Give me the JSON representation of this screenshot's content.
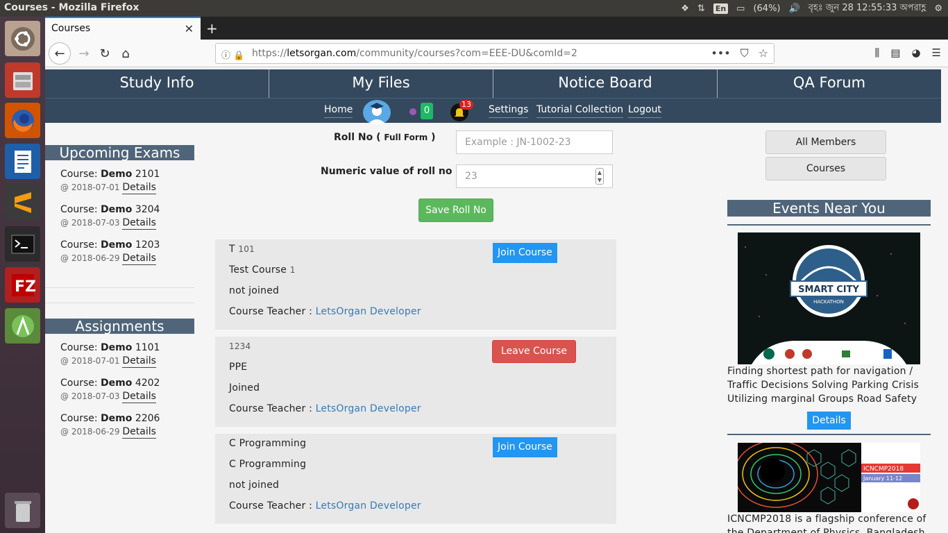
{
  "os": {
    "window_title": "Courses - Mozilla Firefox",
    "lang": "En",
    "battery": "(64%)",
    "datetime": "বৃহঃ জুন 28 12:55:33 অপরাহ্ণ"
  },
  "browser": {
    "tab_label": "Courses",
    "url_domain": "letsorgan.com",
    "url_prefix": "https://",
    "url_path": "/community/courses?com=EEE-DU&comId=2"
  },
  "mainnav": [
    "Study Info",
    "My Files",
    "Notice Board",
    "QA Forum"
  ],
  "subnav": {
    "home": "Home",
    "msg_count": "0",
    "notif_count": "13",
    "settings": "Settings",
    "tutorials": "Tutorial Collection",
    "logout": "Logout"
  },
  "upcoming": {
    "title": "Upcoming Exams",
    "items": [
      {
        "course_label": "Course:",
        "name": "Demo",
        "code": "2101",
        "date": "@ 2018-07-01",
        "link": "Details"
      },
      {
        "course_label": "Course:",
        "name": "Demo",
        "code": "3204",
        "date": "@ 2018-07-03",
        "link": "Details"
      },
      {
        "course_label": "Course:",
        "name": "Demo",
        "code": "1203",
        "date": "@ 2018-06-29",
        "link": "Details"
      }
    ]
  },
  "assignments": {
    "title": "Assignments",
    "items": [
      {
        "course_label": "Course:",
        "name": "Demo",
        "code": "1101",
        "date": "@ 2018-07-01",
        "link": "Details"
      },
      {
        "course_label": "Course:",
        "name": "Demo",
        "code": "4202",
        "date": "@ 2018-07-03",
        "link": "Details"
      },
      {
        "course_label": "Course:",
        "name": "Demo",
        "code": "2206",
        "date": "@ 2018-06-29",
        "link": "Details"
      }
    ]
  },
  "rollform": {
    "roll_label": "Roll No (",
    "roll_small": "Full Form",
    "roll_close": ")",
    "roll_placeholder": "Example  : JN-1002-23",
    "numeric_label": "Numeric value of roll no",
    "numeric_value": "23",
    "save": "Save Roll No"
  },
  "courses": [
    {
      "code": "T",
      "code_sm": "101",
      "title": "Test Course",
      "title_sm": "1",
      "status": "not joined",
      "teacher_label": "Course Teacher :",
      "teacher": "LetsOrgan Developer",
      "action": "Join Course"
    },
    {
      "code": "",
      "code_sm": "1234",
      "title": "PPE",
      "title_sm": "",
      "status": "Joined",
      "teacher_label": "Course Teacher :",
      "teacher": "LetsOrgan Developer",
      "action": "Leave Course"
    },
    {
      "code": "C Programming",
      "code_sm": "",
      "title": "C Programming",
      "title_sm": "",
      "status": "not joined",
      "teacher_label": "Course Teacher :",
      "teacher": "LetsOrgan Developer",
      "action": "Join Course"
    }
  ],
  "right": {
    "all_members": "All Members",
    "courses": "Courses",
    "events_title": "Events Near You",
    "event1_logo": "SMART CITY",
    "event1_sub": "HACKATHON",
    "event1_text": "Finding shortest path for navigation / Traffic Decisions Solving Parking Crisis Utilizing marginal Groups Road Safety",
    "event1_details": "Details",
    "event2_tag": "ICNCMP2018",
    "event2_dates": "January 11-12",
    "event2_text": "ICNCMP2018 is a flagship conference of the Department of Physics, Bangladesh"
  },
  "colors": {
    "nav": "#34495e",
    "header": "#50657a",
    "join": "#2196f3",
    "leave": "#d9534f",
    "save": "#5cb85c",
    "link": "#337ab7"
  }
}
